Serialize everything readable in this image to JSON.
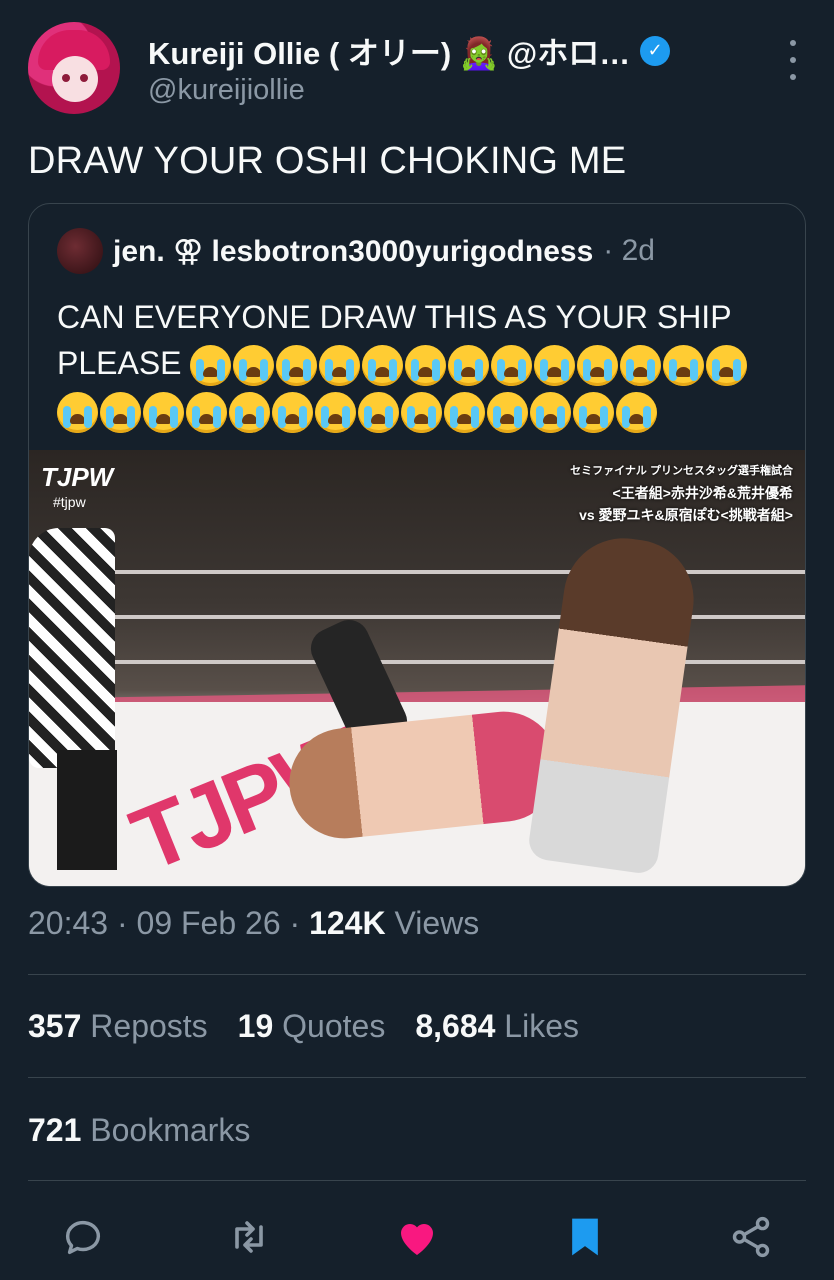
{
  "author": {
    "display_name": "Kureiji Ollie ( オリー) 🧟‍♀️ @ホロ…",
    "handle": "@kureijiollie",
    "verified_mark": "✓"
  },
  "tweet": {
    "text": "DRAW YOUR OSHI CHOKING ME"
  },
  "quote": {
    "display_name": "jen. ⚢ lesbotron3000yurigodness",
    "meta": "· 2d",
    "text": "CAN EVERYONE DRAW THIS AS YOUR SHIP PLEASE",
    "emoji_count": 27,
    "media": {
      "logo": "TJPW",
      "tag": "#tjpw",
      "caption_line1": "セミファイナル プリンセスタッグ選手権試合",
      "caption_line2": "<王者組>赤井沙希&荒井優希",
      "caption_line3": "vs 愛野ユキ&原宿ぽむ<挑戦者組>",
      "mat_text": "TJPW"
    }
  },
  "meta": {
    "time": "20:43",
    "date": "09 Feb 26",
    "views_count": "124K",
    "views_label": "Views"
  },
  "stats": {
    "reposts_count": "357",
    "reposts_label": "Reposts",
    "quotes_count": "19",
    "quotes_label": "Quotes",
    "likes_count": "8,684",
    "likes_label": "Likes",
    "bookmarks_count": "721",
    "bookmarks_label": "Bookmarks"
  },
  "actions": [
    "reply-icon",
    "repost-icon",
    "like-icon",
    "bookmark-icon",
    "share-icon"
  ],
  "colors": {
    "background": "#15202b",
    "verified": "#1d9bf0",
    "like_active": "#f91880",
    "bookmark_active": "#1d9bf0",
    "muted": "#8b98a5"
  }
}
